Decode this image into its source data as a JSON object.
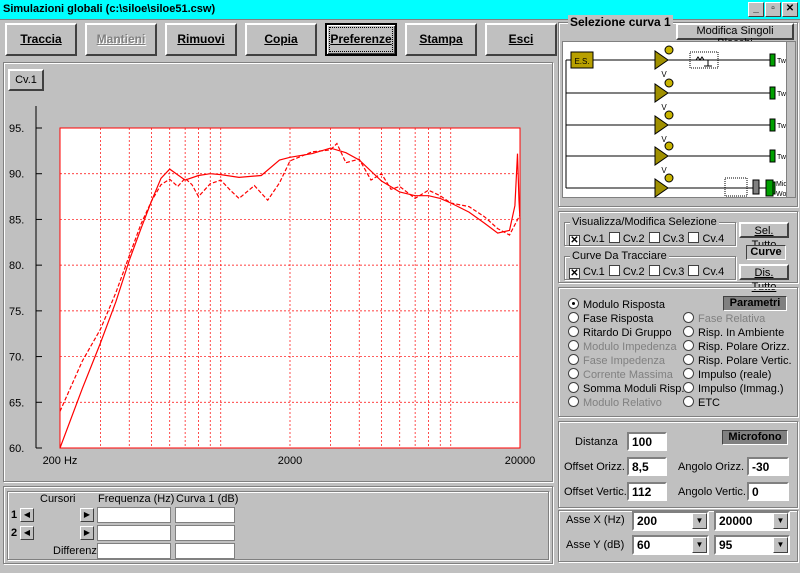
{
  "window": {
    "title": "Simulazioni globali (c:\\siloe\\siloe51.csw)",
    "min_glyph": "_",
    "max_glyph": "▫",
    "close_glyph": "✕"
  },
  "toolbar": {
    "traccia": "Traccia",
    "mantieni": "Mantieni",
    "rimuovi": "Rimuovi",
    "copia": "Copia",
    "preferenze": "Preferenze",
    "stampa": "Stampa",
    "esci": "Esci"
  },
  "graph": {
    "curve_button": "Cv.1",
    "grid_color": "#ff0000",
    "curve_color": "#ff0000"
  },
  "chart_data": {
    "type": "line",
    "xscale": "log",
    "xlim": [
      200,
      20000
    ],
    "ylim": [
      60,
      95
    ],
    "xticks": [
      "200 Hz",
      "2000",
      "20000"
    ],
    "yticks": [
      "60.",
      "65.",
      "70.",
      "75.",
      "80.",
      "85.",
      "90.",
      "95."
    ],
    "series": [
      {
        "style": "solid",
        "x": [
          200,
          250,
          300,
          350,
          400,
          450,
          500,
          550,
          600,
          700,
          800,
          900,
          1000,
          1200,
          1500,
          1800,
          2000,
          2500,
          3000,
          3500,
          4000,
          5000,
          6000,
          7000,
          8000,
          9000,
          10000,
          12000,
          14000,
          16000,
          18000,
          19000,
          19500,
          19800,
          20000
        ],
        "y": [
          60,
          66.5,
          71.5,
          76,
          80.5,
          84,
          87,
          89.5,
          90.5,
          89.3,
          89.8,
          90.0,
          89.9,
          89.6,
          89.8,
          91.5,
          91.8,
          92.2,
          92.8,
          92.3,
          91.5,
          89.2,
          88.0,
          87.6,
          87.6,
          87.3,
          86.8,
          85.8,
          84.6,
          83.5,
          83.8,
          86.5,
          92.2,
          87,
          85
        ]
      },
      {
        "style": "dashed",
        "x": [
          200,
          250,
          300,
          350,
          400,
          450,
          500,
          550,
          600,
          650,
          700,
          750,
          800,
          900,
          1000,
          1100,
          1200,
          1400,
          1600,
          1800,
          2000,
          2500,
          3000,
          3200,
          3500,
          4000,
          4500,
          5000,
          5500,
          6000,
          7000,
          8000,
          9000,
          10000,
          12000,
          14000,
          16000,
          18000,
          20000
        ],
        "y": [
          64,
          69.5,
          73,
          77,
          81,
          84.5,
          87,
          88.8,
          89.4,
          88.6,
          89.5,
          88.8,
          87.5,
          88.9,
          89.3,
          88.2,
          87.3,
          88.7,
          87.1,
          89.0,
          91.4,
          92.4,
          92.6,
          93.3,
          91.2,
          91.6,
          89.3,
          90.0,
          88.3,
          88.6,
          87.3,
          88.2,
          87.6,
          86.8,
          86.4,
          85.3,
          84.0,
          83.3,
          85.5
        ]
      }
    ]
  },
  "selection": {
    "title": "Selezione curva 1",
    "modifica_button": "Modifica Singoli Blocchi",
    "es_label": "E.S.",
    "v_label": "V",
    "tw_label": "Tw",
    "mid_label": "Mid",
    "wof_label": "Wof."
  },
  "visualizza": {
    "group_title": "Visualizza/Modifica Selezione",
    "sel_tutto": "Sel. Tutto",
    "items": [
      {
        "label": "Cv.1",
        "checked": true
      },
      {
        "label": "Cv.2",
        "checked": false
      },
      {
        "label": "Cv.3",
        "checked": false
      },
      {
        "label": "Cv.4",
        "checked": false
      }
    ],
    "curve_header": "Curve",
    "tracciare_title": "Curve Da Tracciare",
    "dis_tutto": "Dis. Tutto",
    "tr_items": [
      {
        "label": "Cv.1",
        "checked": true
      },
      {
        "label": "Cv.2",
        "checked": false
      },
      {
        "label": "Cv.3",
        "checked": false
      },
      {
        "label": "Cv.4",
        "checked": false
      }
    ]
  },
  "parametri": {
    "header": "Parametri",
    "left": [
      {
        "label": "Modulo Risposta",
        "selected": true,
        "enabled": true
      },
      {
        "label": "Fase Risposta",
        "selected": false,
        "enabled": true
      },
      {
        "label": "Ritardo Di Gruppo",
        "selected": false,
        "enabled": true
      },
      {
        "label": "Modulo Impedenza",
        "selected": false,
        "enabled": false
      },
      {
        "label": "Fase Impedenza",
        "selected": false,
        "enabled": false
      },
      {
        "label": "Corrente Massima",
        "selected": false,
        "enabled": false
      },
      {
        "label": "Somma Moduli Risp.",
        "selected": false,
        "enabled": true
      },
      {
        "label": "Modulo Relativo",
        "selected": false,
        "enabled": false
      }
    ],
    "right": [
      {
        "label": "Fase Relativa",
        "selected": false,
        "enabled": false
      },
      {
        "label": "Risp. In Ambiente",
        "selected": false,
        "enabled": true
      },
      {
        "label": "Risp. Polare Orizz.",
        "selected": false,
        "enabled": true
      },
      {
        "label": "Risp. Polare Vertic.",
        "selected": false,
        "enabled": true
      },
      {
        "label": "Impulso (reale)",
        "selected": false,
        "enabled": true
      },
      {
        "label": "Impulso (Immag.)",
        "selected": false,
        "enabled": true
      },
      {
        "label": "ETC",
        "selected": false,
        "enabled": true
      }
    ]
  },
  "microfono": {
    "header": "Microfono",
    "distanza_label": "Distanza",
    "distanza": "100",
    "offset_orizz_label": "Offset Orizz.",
    "offset_orizz": "8,5",
    "angolo_orizz_label": "Angolo Orizz.",
    "angolo_orizz": "-30",
    "offset_vertic_label": "Offset Vertic.",
    "offset_vertic": "112",
    "angolo_vertic_label": "Angolo Vertic.",
    "angolo_vertic": "0"
  },
  "assi": {
    "x_label": "Asse X",
    "x_unit": "(Hz)",
    "x_min": "200",
    "x_max": "20000",
    "y_label": "Asse Y",
    "y_unit": "(dB)",
    "y_min": "60",
    "y_max": "95"
  },
  "cursori": {
    "title": "Cursori",
    "freq_header": "Frequenza (Hz)",
    "curve_header": "Curva 1 (dB)",
    "row1": "1",
    "row2": "2",
    "differenza": "Differenza"
  }
}
